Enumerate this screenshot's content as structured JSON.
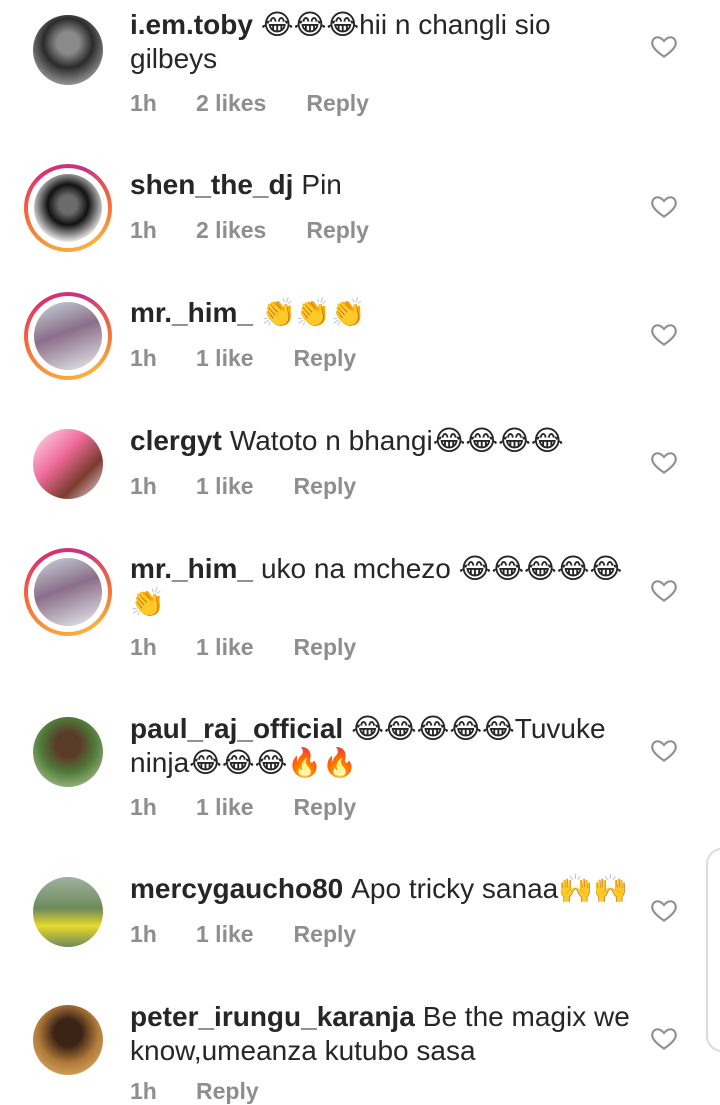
{
  "comments": [
    {
      "username": "i.em.toby",
      "text": "😂😂😂hii n changli sio gilbeys",
      "time": "1h",
      "likes": "2 likes",
      "reply": "Reply",
      "story": false,
      "avatar_colors": [
        "#2b2b2b",
        "#8a8a8a",
        "#e0e0e0"
      ]
    },
    {
      "username": "shen_the_dj",
      "text": "Pin",
      "time": "1h",
      "likes": "2 likes",
      "reply": "Reply",
      "story": true,
      "avatar_colors": [
        "#111111",
        "#6b6b6b",
        "#f2f2f2"
      ]
    },
    {
      "username": "mr._him_",
      "text": "👏👏👏",
      "time": "1h",
      "likes": "1 like",
      "reply": "Reply",
      "story": true,
      "avatar_colors": [
        "#c7d7dc",
        "#8b6e88",
        "#e9eef0"
      ]
    },
    {
      "username": "clergyt",
      "text": "Watoto n bhangi😂😂😂😂",
      "time": "1h",
      "likes": "1 like",
      "reply": "Reply",
      "story": false,
      "avatar_colors": [
        "#f06b9a",
        "#7a3b2e",
        "#fbe3ea"
      ]
    },
    {
      "username": "mr._him_",
      "text": "uko na mchezo 😂😂😂😂😂👏",
      "time": "1h",
      "likes": "1 like",
      "reply": "Reply",
      "story": true,
      "avatar_colors": [
        "#c7d7dc",
        "#8b6e88",
        "#e9eef0"
      ]
    },
    {
      "username": "paul_raj_official",
      "text": "😂😂😂😂😂Tuvuke ninja😂😂😂🔥🔥",
      "time": "1h",
      "likes": "1 like",
      "reply": "Reply",
      "story": false,
      "avatar_colors": [
        "#4f7a3a",
        "#5a3a28",
        "#c9d9a8"
      ]
    },
    {
      "username": "mercygaucho80",
      "text": "Apo tricky sanaa🙌🙌",
      "time": "1h",
      "likes": "1 like",
      "reply": "Reply",
      "story": false,
      "avatar_colors": [
        "#6d8a5a",
        "#e7d92c",
        "#9fb2a0"
      ]
    },
    {
      "username": "peter_irungu_karanja",
      "text": "Be the magix we know,umeanza kutubo sasa",
      "time": "1h",
      "likes": "",
      "reply": "Reply",
      "story": false,
      "avatar_colors": [
        "#b07a3a",
        "#3b2416",
        "#f0c070"
      ]
    }
  ],
  "icons": {
    "heart": "heart-outline-icon"
  },
  "colors": {
    "text": "#262626",
    "meta": "#8e8e8e",
    "heart_stroke": "#8e8e8e"
  }
}
